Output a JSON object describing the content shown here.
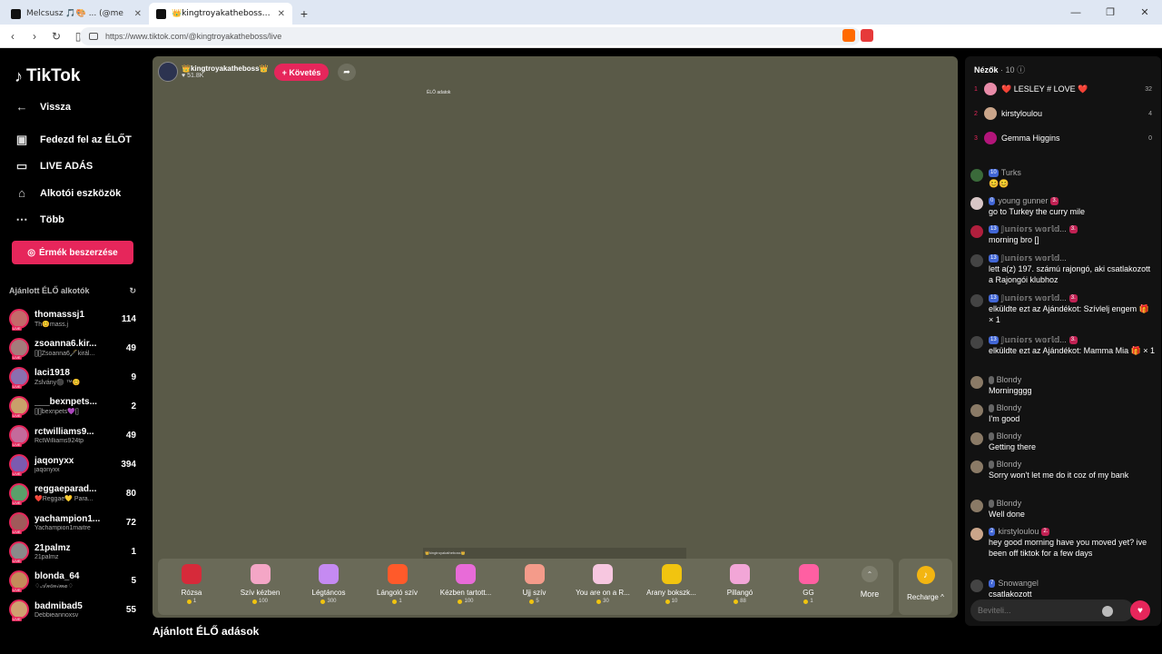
{
  "browser": {
    "tabs": [
      {
        "title": "Melcsusz 🎵🎨 ... (@me",
        "active": false
      },
      {
        "title": "👑kingtroyakatheboss👑 (@kin",
        "active": true
      }
    ],
    "url": "https://www.tiktok.com/@kingtroyakatheboss/live"
  },
  "sidebar": {
    "logo": "TikTok",
    "nav": [
      {
        "label": "Vissza",
        "icon": "back-arrow-icon"
      },
      {
        "label": "Fedezd fel az ÉLŐT",
        "icon": "tv-icon"
      },
      {
        "label": "LIVE ADÁS",
        "icon": "camera-icon"
      },
      {
        "label": "Alkotói eszközök",
        "icon": "home-icon"
      },
      {
        "label": "Több",
        "icon": "more-icon"
      }
    ],
    "coins_button": "Érmék beszerzése",
    "section_title": "Ajánlott ÉLŐ alkotók",
    "creators": [
      {
        "name": "thomasssj1",
        "sub": "Th😊mass.j",
        "count": "114"
      },
      {
        "name": "zsoanna6.kir...",
        "sub": "[][]Zsoanna6🖋️királ...",
        "count": "49"
      },
      {
        "name": "laci1918",
        "sub": "Zslvány⚫ ™😊",
        "count": "9"
      },
      {
        "name": "___bexnpets...",
        "sub": "[][]bexnpets💜[]",
        "count": "2"
      },
      {
        "name": "rctwilliams9...",
        "sub": "RctWilliams924tp",
        "count": "49"
      },
      {
        "name": "jaqonyxx",
        "sub": "jaqonyxx",
        "count": "394"
      },
      {
        "name": "reggaeparad...",
        "sub": "❤️Reggae💛 Para...",
        "count": "80"
      },
      {
        "name": "yachampion1...",
        "sub": "Yachampion1maitre",
        "count": "72"
      },
      {
        "name": "21palmz",
        "sub": "21palmz",
        "count": "1"
      },
      {
        "name": "blonda_64",
        "sub": "♢𝒜𝓃𝑜𝓃𝒾𝓂𝒶♢",
        "count": "5"
      },
      {
        "name": "badmibad5",
        "sub": "Debbieannoxsv",
        "count": "55"
      }
    ],
    "colors": {
      "accent": "#e6265b"
    }
  },
  "stream": {
    "host_name": "👑kingtroyakatheboss👑",
    "host_likes": "51.8K",
    "follow_label": "+ Követés",
    "tiny_label": "ÉLŐ adatok",
    "tiny_bar_text": "👑kingtroyakatheboss👑",
    "gifts": [
      {
        "name": "Rózsa",
        "price": "1",
        "color": "#d62a3a"
      },
      {
        "name": "Szív kézben",
        "price": "100",
        "color": "#f4a6c6"
      },
      {
        "name": "Légtáncos",
        "price": "300",
        "color": "#c58af2"
      },
      {
        "name": "Lángoló szív",
        "price": "1",
        "color": "#ff5a2a"
      },
      {
        "name": "Kézben tartott...",
        "price": "100",
        "color": "#e86bd8"
      },
      {
        "name": "Ujj szív",
        "price": "5",
        "color": "#f49b8a"
      },
      {
        "name": "You are on a R...",
        "price": "30",
        "color": "#f7c7e0"
      },
      {
        "name": "Arany bokszk...",
        "price": "10",
        "color": "#f1c40f"
      },
      {
        "name": "Pillangó",
        "price": "88",
        "color": "#f2a6d7"
      },
      {
        "name": "GG",
        "price": "1",
        "color": "#ff5fa2"
      }
    ],
    "more_label": "More",
    "recharge_label": "Recharge ^",
    "recommended_title": "Ajánlott ÉLŐ adások"
  },
  "chat": {
    "viewers_title": "Nézők",
    "viewers_count": "· 10",
    "top_viewers": [
      {
        "rank": "1",
        "name": "❤️ LESLEY # LOVE ❤️",
        "score": "32",
        "color": "#e88ba8"
      },
      {
        "rank": "2",
        "name": "kirstyloulou",
        "score": "4",
        "color": "#caa58a"
      },
      {
        "rank": "3",
        "name": "Gemma Higgins",
        "score": "0",
        "color": "#b3157a"
      }
    ],
    "messages": [
      {
        "user": "Turks",
        "level": "10",
        "text": "😊😊",
        "color": "#3a6a3a"
      },
      {
        "user": "young gunner",
        "level": "0",
        "fan": "3.",
        "text": "go to Turkey the curry mile",
        "color": "#d8c6c6"
      },
      {
        "user": "𝕁𝕦𝕟𝕚𝕠𝕣𝕤 𝕨𝕠𝕣𝕝𝕕...",
        "level": "13",
        "fan": "3.",
        "text": "morning bro []",
        "color": "#b01f3d"
      },
      {
        "user": "𝕁𝕦𝕟𝕚𝕠𝕣𝕤 𝕨𝕠𝕣𝕝𝕕...",
        "level": "13",
        "text": "lett a(z) 197. számú rajongó, aki csatlakozott a Rajongói klubhoz",
        "color": "#444"
      },
      {
        "user": "𝕁𝕦𝕟𝕚𝕠𝕣𝕤 𝕨𝕠𝕣𝕝𝕕...",
        "level": "13",
        "fan": "3.",
        "text": "elküldte ezt az Ajándékot: Szívlelj engem 🎁 × 1",
        "color": "#444"
      },
      {
        "user": "𝕁𝕦𝕟𝕚𝕠𝕣𝕤 𝕨𝕠𝕣𝕝𝕕...",
        "level": "13",
        "fan": "3.",
        "text": "elküldte ezt az Ajándékot: Mamma Mia 🎁 × 1",
        "color": "#444"
      },
      {
        "user": "Blondy",
        "level": "",
        "text": "Morningggg",
        "color": "#8a7a66"
      },
      {
        "user": "Blondy",
        "level": "",
        "text": "I'm good",
        "color": "#8a7a66"
      },
      {
        "user": "Blondy",
        "level": "",
        "text": "Getting there",
        "color": "#8a7a66"
      },
      {
        "user": "Blondy",
        "level": "",
        "text": "Sorry won't let me do it coz of my bank",
        "color": "#8a7a66"
      },
      {
        "user": "Blondy",
        "level": "",
        "text": "Well done",
        "color": "#8a7a66"
      },
      {
        "user": "kirstyloulou",
        "level": "2",
        "fan": "2.",
        "text": "hey good morning have you moved yet? ive been off tiktok for a few days",
        "color": "#caa58a"
      },
      {
        "user": "Snowangel",
        "level": "7",
        "text": "csatlakozott",
        "color": "#444"
      }
    ],
    "input_placeholder": "Beviteli..."
  }
}
